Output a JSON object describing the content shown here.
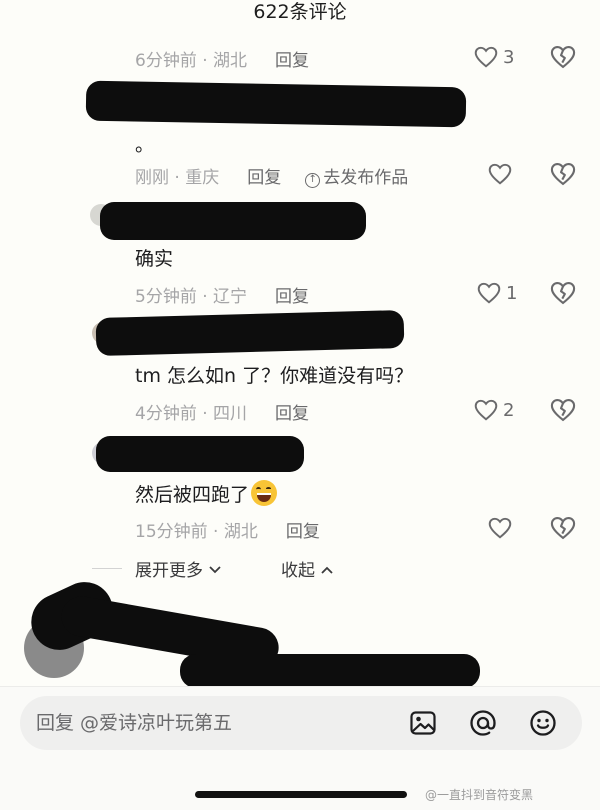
{
  "header": {
    "title": "622条评论"
  },
  "comments": [
    {
      "meta": "6分钟前 · 湖北",
      "reply": "回复",
      "likes": "3",
      "text": ""
    },
    {
      "meta": "刚刚 · 重庆",
      "reply": "回复",
      "publish": "去发布作品",
      "likes": "",
      "text": "。"
    },
    {
      "meta": "5分钟前 · 辽宁",
      "reply": "回复",
      "likes": "1",
      "text": "确实"
    },
    {
      "meta": "4分钟前 · 四川",
      "reply": "回复",
      "likes": "2",
      "text": "tm 怎么如n 了？你难道没有吗？"
    },
    {
      "meta": "15分钟前 · 湖北",
      "reply": "回复",
      "likes": "",
      "text": "然后被四跑了"
    }
  ],
  "thread": {
    "expand_more": "展开更多",
    "collapse": "收起"
  },
  "composer": {
    "placeholder": "回复 @爱诗凉叶玩第五"
  },
  "watermark": "@一直抖到音符变黑",
  "colors": {
    "background": "#fdfdf9",
    "meta_gray": "#a5a5a7",
    "icon_gray": "#6a6a6c",
    "redaction": "#0d0d0d"
  },
  "icons": [
    "heart-icon",
    "broken-heart-icon",
    "upload-icon",
    "image-icon",
    "at-icon",
    "smiley-icon",
    "chevron-down-icon",
    "chevron-up-icon"
  ]
}
